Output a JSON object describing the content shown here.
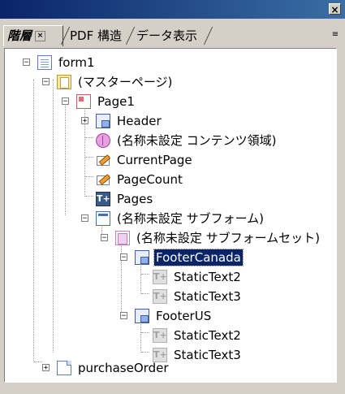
{
  "window": {
    "close_label": "×"
  },
  "tabs": [
    {
      "label": "階層",
      "close": "×",
      "active": true
    },
    {
      "label": "PDF 構造",
      "active": false
    },
    {
      "label": "データ表示",
      "active": false
    }
  ],
  "panel_menu_icon": "≡",
  "tree": [
    {
      "id": "form1",
      "label": "form1",
      "icon": "document-icon",
      "expander": "−"
    },
    {
      "id": "master",
      "label": "(マスターページ)",
      "icon": "master-pages-icon",
      "expander": "−"
    },
    {
      "id": "page1",
      "label": "Page1",
      "icon": "page-icon",
      "expander": "−"
    },
    {
      "id": "header",
      "label": "Header",
      "icon": "subform-icon",
      "expander": "+"
    },
    {
      "id": "contentarea",
      "label": "(名称未設定 コンテンツ領域)",
      "icon": "content-area-icon"
    },
    {
      "id": "currentpage",
      "label": "CurrentPage",
      "icon": "text-field-icon"
    },
    {
      "id": "pagecount",
      "label": "PageCount",
      "icon": "text-field-icon"
    },
    {
      "id": "pages",
      "label": "Pages",
      "icon": "pages-icon",
      "icon_text": "T+"
    },
    {
      "id": "unnamed-subform",
      "label": "(名称未設定 サブフォーム)",
      "icon": "subform-page-icon",
      "expander": "−"
    },
    {
      "id": "subformset",
      "label": "(名称未設定 サブフォームセット)",
      "icon": "subform-set-icon",
      "expander": "−"
    },
    {
      "id": "footercanada",
      "label": "FooterCanada",
      "icon": "subform-icon",
      "expander": "−",
      "selected": true
    },
    {
      "id": "fc-static2",
      "label": "StaticText2",
      "icon": "static-text-icon",
      "icon_text": "T+"
    },
    {
      "id": "fc-static3",
      "label": "StaticText3",
      "icon": "static-text-icon",
      "icon_text": "T+"
    },
    {
      "id": "footerus",
      "label": "FooterUS",
      "icon": "subform-icon",
      "expander": "−"
    },
    {
      "id": "fu-static2",
      "label": "StaticText2",
      "icon": "static-text-icon",
      "icon_text": "T+"
    },
    {
      "id": "fu-static3",
      "label": "StaticText3",
      "icon": "static-text-icon",
      "icon_text": "T+"
    },
    {
      "id": "purchaseorder",
      "label": "purchaseOrder",
      "icon": "file-icon",
      "expander": "+"
    }
  ]
}
